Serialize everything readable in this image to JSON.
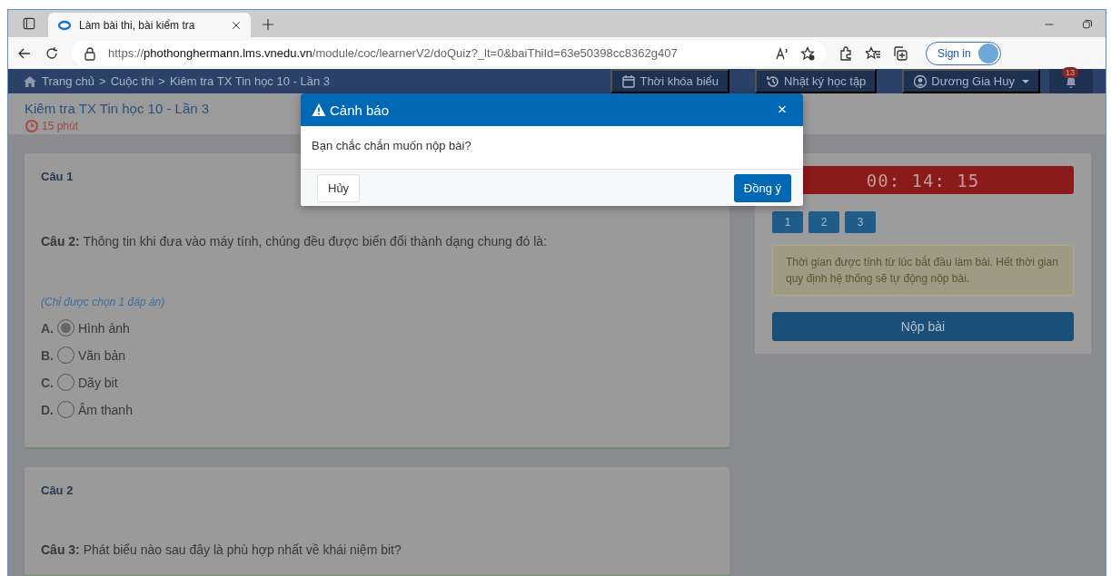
{
  "browser": {
    "tab": {
      "title": "Làm bài thi, bài kiểm tra",
      "selected": true
    },
    "url": {
      "scheme": "https://",
      "host": "phothonghermann.lms.vnedu.vn",
      "path": "/module/coc/learnerV2/doQuiz?_lt=0&baiThiId=63e50398cc8362g407"
    },
    "sign_in": "Sign in"
  },
  "nav": {
    "separator": ">",
    "breadcrumb": [
      "Trang chủ",
      "Cuộc thi",
      "Kiêm tra TX Tin học 10 - Lần 3"
    ],
    "buttons": [
      {
        "label": "Thời khóa biểu",
        "kind": "calendar"
      },
      {
        "label": "Nhật ký học tập",
        "kind": "history"
      },
      {
        "label": "Dương Gia Huy",
        "kind": "user"
      }
    ],
    "notification_count": "13"
  },
  "quiz": {
    "title": "Kiêm tra TX Tin học 10 - Lần 3",
    "duration": "15 phút"
  },
  "questions": [
    {
      "heading": "Câu 1",
      "prompt": "**Câu 2:** Thông tin khi đưa vào máy tính, chúng đều được biến đổi thành dạng chung đó là:",
      "hint": "(Chỉ được chọn 1 đáp án)",
      "options": [
        {
          "letter": "A.",
          "text": "Hình ảnh",
          "selected": true
        },
        {
          "letter": "B.",
          "text": "Văn bản",
          "selected": false
        },
        {
          "letter": "C.",
          "text": "Dãy bit",
          "selected": false
        },
        {
          "letter": "D.",
          "text": "Âm thanh",
          "selected": false
        }
      ]
    },
    {
      "heading": "Câu 2",
      "prompt": "**Câu 3:** Phát biểu nào sau đây là phù hợp nhất về khái niệm bit?"
    }
  ],
  "sidebar": {
    "timer": "00: 14: 15",
    "question_buttons": [
      "1",
      "2",
      "3"
    ],
    "notice": "Thời gian được tính từ lúc bắt đầu làm bài. Hết thời gian quy định hệ thống sẽ tự động nộp bài.",
    "submit": "Nộp bài"
  },
  "dialog": {
    "title": "Cảnh báo",
    "close": "×",
    "message": "Bạn chắc chắn muốn nộp bài?",
    "buttons": [
      {
        "label": "Hủy",
        "kind": "secondary"
      },
      {
        "label": "Đồng ý",
        "kind": "primary"
      }
    ]
  }
}
